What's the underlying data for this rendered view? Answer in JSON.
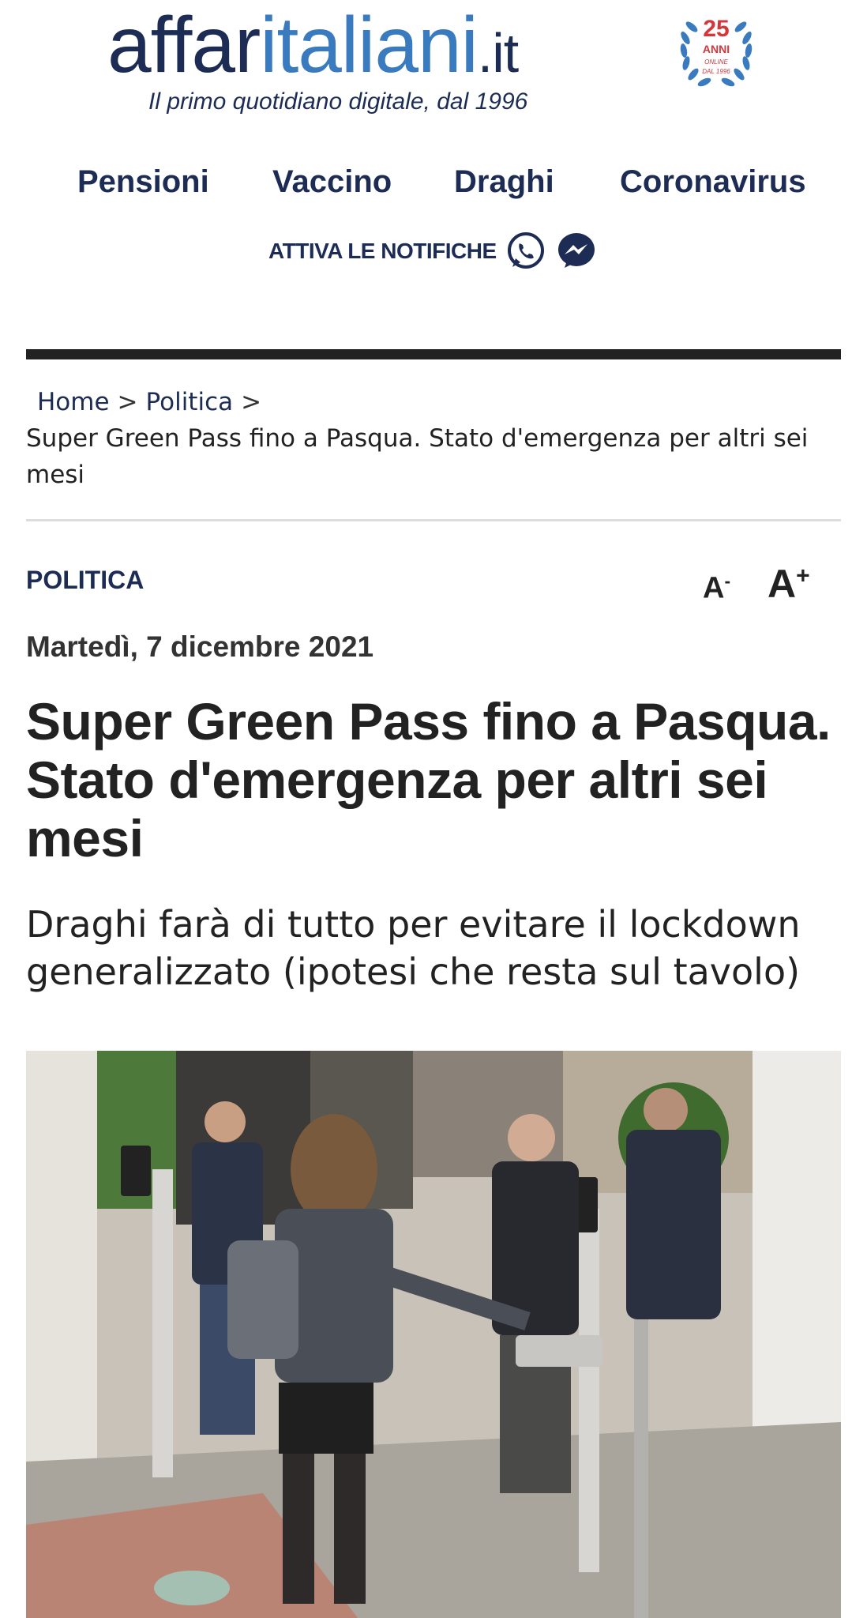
{
  "header": {
    "logo_part1": "affar",
    "logo_part2": "italiani",
    "logo_part3": ".it",
    "tagline": "Il primo quotidiano digitale, dal 1996",
    "badge_number": "25",
    "badge_word": "ANNI",
    "badge_line1": "ONLINE",
    "badge_line2": "DAL 1996"
  },
  "nav": {
    "items": [
      {
        "label": "Pensioni"
      },
      {
        "label": "Vaccino"
      },
      {
        "label": "Draghi"
      },
      {
        "label": "Coronavirus"
      }
    ],
    "notifications_label": "ATTIVA LE NOTIFICHE",
    "icons": [
      "whatsapp-icon",
      "messenger-icon"
    ]
  },
  "breadcrumb": {
    "home": "Home",
    "section": "Politica",
    "separator": ">",
    "current": "Super Green Pass fino a Pasqua. Stato d'emergenza per altri sei mesi"
  },
  "article": {
    "category": "POLITICA",
    "font_decrease_label": "A",
    "font_decrease_sign": "-",
    "font_increase_label": "A",
    "font_increase_sign": "+",
    "date": "Martedì, 7 dicembre 2021",
    "title": "Super Green Pass fino a Pasqua. Stato d'emergenza per altri sei mesi",
    "subtitle": "Draghi farà di tutto per evitare il lockdown generalizzato (ipotesi che resta sul tavolo)"
  },
  "colors": {
    "brand_dark": "#1d2c55",
    "brand_light": "#3a7bbf",
    "badge_red": "#d6363a",
    "text": "#222222"
  }
}
